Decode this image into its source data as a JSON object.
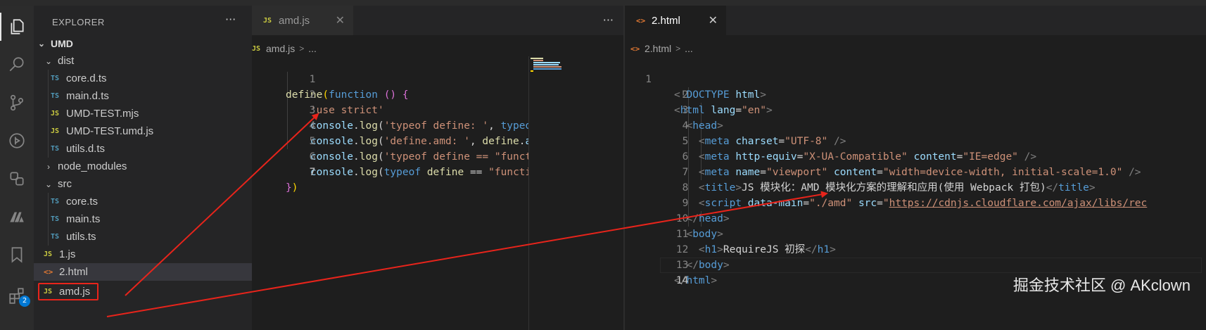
{
  "activity_bar": {
    "icons": [
      "files-icon",
      "search-icon",
      "source-control-icon",
      "run-debug-icon",
      "remote-icon",
      "extension-m-icon",
      "bookmark-icon",
      "extensions-icon"
    ],
    "badge": "2"
  },
  "sidebar": {
    "title": "EXPLORER",
    "more": "···",
    "root": "UMD",
    "items": [
      {
        "label": "dist",
        "type": "folder"
      },
      {
        "label": "core.d.ts",
        "icon": "TS"
      },
      {
        "label": "main.d.ts",
        "icon": "TS"
      },
      {
        "label": "UMD-TEST.mjs",
        "icon": "JS"
      },
      {
        "label": "UMD-TEST.umd.js",
        "icon": "JS"
      },
      {
        "label": "utils.d.ts",
        "icon": "TS"
      },
      {
        "label": "node_modules",
        "type": "folder"
      },
      {
        "label": "src",
        "type": "folder"
      },
      {
        "label": "core.ts",
        "icon": "TS"
      },
      {
        "label": "main.ts",
        "icon": "TS"
      },
      {
        "label": "utils.ts",
        "icon": "TS"
      },
      {
        "label": "1.js",
        "icon": "JS"
      },
      {
        "label": "2.html",
        "icon": "<>"
      },
      {
        "label": "amd.js",
        "icon": "JS"
      }
    ]
  },
  "editor_left": {
    "tab": {
      "icon": "JS",
      "label": "amd.js",
      "close": "✕"
    },
    "more": "···",
    "breadcrumb": {
      "icon": "JS",
      "file": "amd.js",
      "sep": ">",
      "rest": "..."
    },
    "line_numbers": [
      "1",
      "2",
      "3",
      "4",
      "5",
      "6",
      "7"
    ],
    "lines": [
      "define(function () {",
      "    'use strict'",
      "    console.log('typeof define: ', typeof",
      "    console.log('define.amd: ', define.a",
      "    console.log('typeof define == \"funct",
      "    console.log(typeof define == \"functi",
      "})"
    ]
  },
  "editor_right": {
    "tab": {
      "icon": "<>",
      "label": "2.html",
      "close": "✕"
    },
    "breadcrumb": {
      "icon": "<>",
      "file": "2.html",
      "sep": ">",
      "rest": "..."
    },
    "line_numbers": [
      "1",
      "2",
      "3",
      "4",
      "5",
      "6",
      "7",
      "8",
      "9",
      "10",
      "11",
      "12",
      "13",
      "14"
    ],
    "lines": [
      "<!DOCTYPE html>",
      "<html lang=\"en\">",
      "  <head>",
      "    <meta charset=\"UTF-8\" />",
      "    <meta http-equiv=\"X-UA-Compatible\" content=\"IE=edge\" />",
      "    <meta name=\"viewport\" content=\"width=device-width, initial-scale=1.0\" />",
      "    <title>JS 模块化：AMD 模块化方案的理解和应用(使用 Webpack 打包)</title>",
      "    <script data-main=\"./amd\" src=\"https://cdnjs.cloudflare.com/ajax/libs/rec",
      "  </head>",
      "  <body>",
      "    <h1>RequireJS 初探</h1>",
      "  </body>",
      "</html>",
      ""
    ]
  },
  "watermark": "掘金技术社区 @ AKclown",
  "colors": {
    "annotation_red": "#e8241b",
    "editor_bg": "#1e1e1e",
    "sidebar_bg": "#252526",
    "keyword": "#569cd6",
    "string": "#ce9178",
    "function": "#dcdcaa"
  }
}
